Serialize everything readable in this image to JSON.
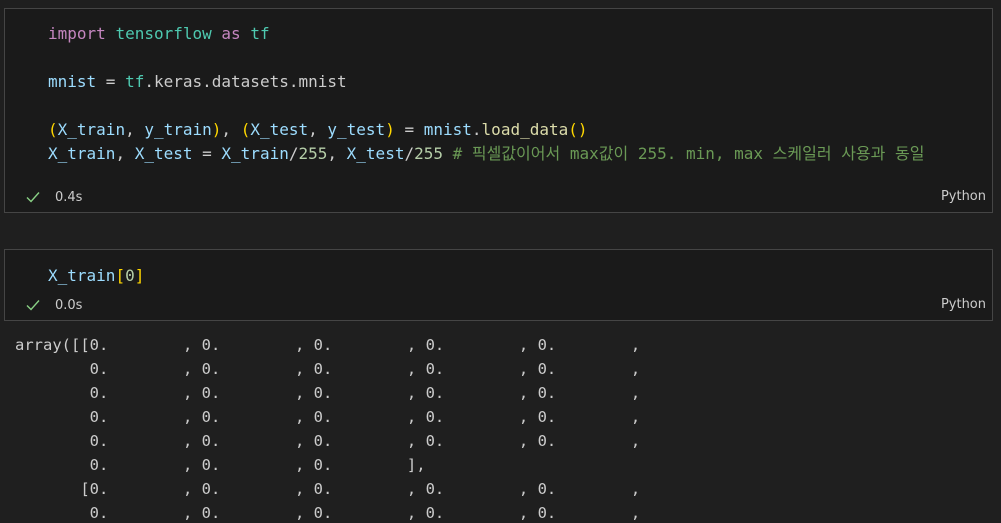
{
  "cell1": {
    "lines": [
      [
        {
          "t": "import",
          "c": "kw"
        },
        {
          "t": " ",
          "c": "pun"
        },
        {
          "t": "tensorflow",
          "c": "mod"
        },
        {
          "t": " ",
          "c": "pun"
        },
        {
          "t": "as",
          "c": "kw"
        },
        {
          "t": " ",
          "c": "pun"
        },
        {
          "t": "tf",
          "c": "mod"
        }
      ],
      [],
      [
        {
          "t": "mnist",
          "c": "var"
        },
        {
          "t": " = ",
          "c": "pun"
        },
        {
          "t": "tf",
          "c": "mod"
        },
        {
          "t": ".keras.datasets.mnist",
          "c": "pun"
        }
      ],
      [],
      [
        {
          "t": "(",
          "c": "par1"
        },
        {
          "t": "X_train",
          "c": "var"
        },
        {
          "t": ", ",
          "c": "pun"
        },
        {
          "t": "y_train",
          "c": "var"
        },
        {
          "t": ")",
          "c": "par1"
        },
        {
          "t": ", ",
          "c": "pun"
        },
        {
          "t": "(",
          "c": "par1"
        },
        {
          "t": "X_test",
          "c": "var"
        },
        {
          "t": ", ",
          "c": "pun"
        },
        {
          "t": "y_test",
          "c": "var"
        },
        {
          "t": ")",
          "c": "par1"
        },
        {
          "t": " = ",
          "c": "pun"
        },
        {
          "t": "mnist",
          "c": "var"
        },
        {
          "t": ".",
          "c": "pun"
        },
        {
          "t": "load_data",
          "c": "fn"
        },
        {
          "t": "()",
          "c": "par1"
        }
      ],
      [
        {
          "t": "X_train",
          "c": "var"
        },
        {
          "t": ", ",
          "c": "pun"
        },
        {
          "t": "X_test",
          "c": "var"
        },
        {
          "t": " = ",
          "c": "pun"
        },
        {
          "t": "X_train",
          "c": "var"
        },
        {
          "t": "/",
          "c": "pun"
        },
        {
          "t": "255",
          "c": "num"
        },
        {
          "t": ", ",
          "c": "pun"
        },
        {
          "t": "X_test",
          "c": "var"
        },
        {
          "t": "/",
          "c": "pun"
        },
        {
          "t": "255",
          "c": "num"
        },
        {
          "t": " # 픽셀값이어서 max값이 255. min, max 스케일러 사용과 동일",
          "c": "cmt"
        }
      ]
    ],
    "status_time": "0.4s",
    "language": "Python"
  },
  "cell2": {
    "lines": [
      [
        {
          "t": "X_train",
          "c": "var"
        },
        {
          "t": "[",
          "c": "par1"
        },
        {
          "t": "0",
          "c": "num"
        },
        {
          "t": "]",
          "c": "par1"
        }
      ]
    ],
    "status_time": "0.0s",
    "language": "Python"
  },
  "output": {
    "lines": [
      "array([[0.        , 0.        , 0.        , 0.        , 0.        ,",
      "        0.        , 0.        , 0.        , 0.        , 0.        ,",
      "        0.        , 0.        , 0.        , 0.        , 0.        ,",
      "        0.        , 0.        , 0.        , 0.        , 0.        ,",
      "        0.        , 0.        , 0.        , 0.        , 0.        ,",
      "        0.        , 0.        , 0.        ],",
      "       [0.        , 0.        , 0.        , 0.        , 0.        ,",
      "        0.        , 0.        , 0.        , 0.        , 0.        ,"
    ]
  },
  "icons": {
    "success": "check-icon"
  },
  "colors": {
    "background": "#1f1f1f",
    "cell_border": "#454545",
    "success_check": "#89d185"
  }
}
